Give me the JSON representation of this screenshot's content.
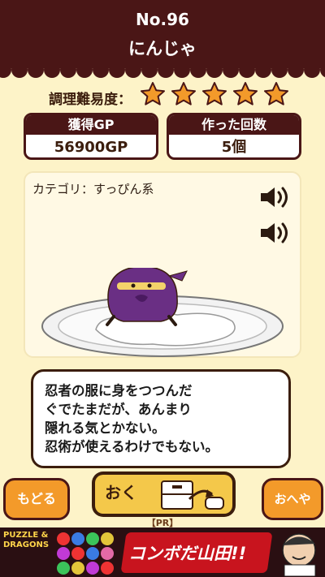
{
  "header": {
    "number": "No.96",
    "name": "にんじゃ"
  },
  "difficulty": {
    "label": "調理難易度：",
    "stars": 5,
    "max_stars": 5,
    "star_color": "#f39a2a"
  },
  "stats": [
    {
      "label": "獲得GP",
      "value": "56900GP"
    },
    {
      "label": "作った回数",
      "value": "5個"
    }
  ],
  "category": "カテゴリ：すっぴん系",
  "description": [
    "忍者の服に身をつつんだ",
    "ぐでたまだが、あんまり",
    "隠れる気とかない。",
    "忍術が使えるわけでもない。"
  ],
  "buttons": {
    "back": "もどる",
    "place": "おく",
    "room": "おへや"
  },
  "ad": {
    "pr": "【PR】",
    "game_title": "PUZZLE & DRAGONS",
    "slogan": "コンボだ山田!!"
  },
  "colors": {
    "header": "#4a1616",
    "background": "#fdf3c8",
    "accent": "#f39a2a"
  }
}
